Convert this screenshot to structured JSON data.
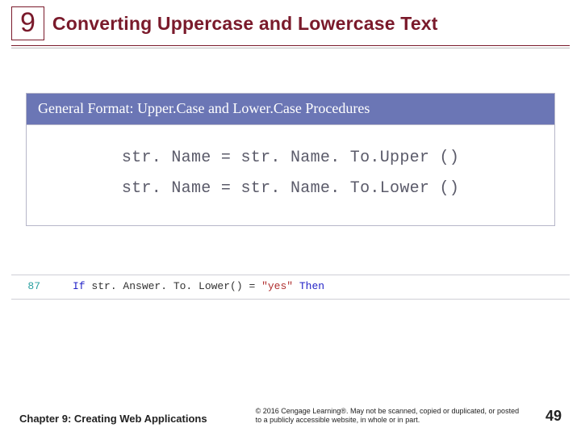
{
  "header": {
    "chapter_number": "9",
    "title": "Converting Uppercase and Lowercase Text"
  },
  "figure": {
    "heading": "General Format: Upper.Case and Lower.Case Procedures",
    "lines": [
      "str. Name = str. Name. To.Upper ()",
      "str. Name = str. Name. To.Lower ()"
    ]
  },
  "snippet": {
    "lineno": "87",
    "kw_if": "If",
    "expr": " str. Answer. To. Lower() ",
    "op": "= ",
    "literal": "\"yes\"",
    "kw_then": " Then"
  },
  "footer": {
    "chapter_label": "Chapter 9: Creating Web Applications",
    "copyright": "© 2016 Cengage Learning®. May not be scanned, copied or duplicated, or posted to a publicly accessible website, in whole or in part.",
    "page": "49"
  }
}
